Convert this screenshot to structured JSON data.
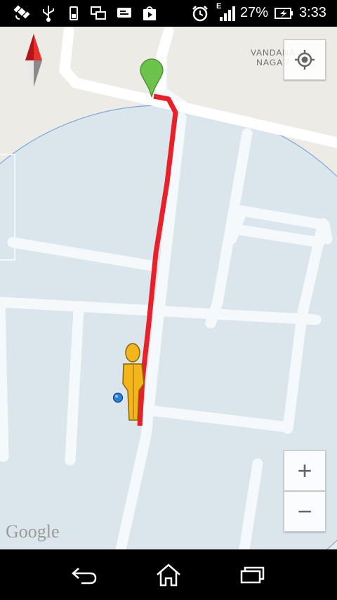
{
  "status_bar": {
    "battery_percent": "27%",
    "time": "3:33",
    "network_type": "E",
    "icons": [
      "satellite-icon",
      "usb-icon",
      "phone-icon",
      "screens-icon",
      "notification-icon",
      "store-icon",
      "alarm-icon",
      "signal-icon",
      "battery-charging-icon"
    ]
  },
  "map": {
    "place_label": "VANDANA\nNAGAR",
    "attribution": "Google",
    "zoom_in_label": "+",
    "zoom_out_label": "−",
    "route_color": "#e8202a",
    "accuracy_circle_color": "#c9dcef",
    "marker_color": "#6cc24a",
    "person_color": "#f2b51c"
  },
  "nav_bar": {
    "buttons": [
      "back-icon",
      "home-icon",
      "recents-icon"
    ]
  }
}
